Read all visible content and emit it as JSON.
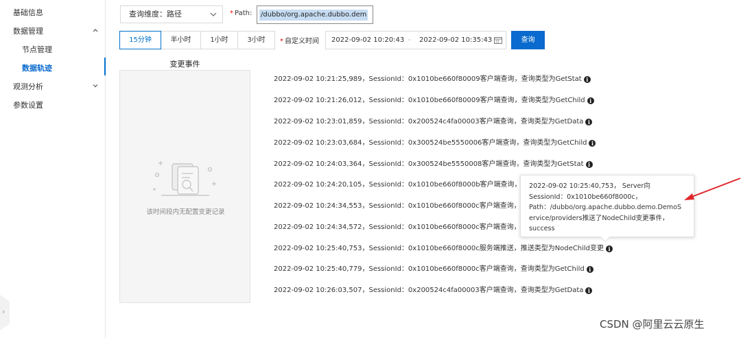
{
  "sidebar": {
    "items": [
      {
        "label": "基础信息"
      },
      {
        "label": "数据管理"
      },
      {
        "label": "节点管理"
      },
      {
        "label": "数据轨迹"
      },
      {
        "label": "观测分析"
      },
      {
        "label": "参数设置"
      }
    ]
  },
  "filters": {
    "dimension": "查询维度：路径",
    "path_label": "Path:",
    "path_value": "/dubbo/org.apache.dubbo.dem",
    "time_options": [
      "15分钟",
      "半小时",
      "1小时",
      "3小时"
    ],
    "selected_time": "15分钟",
    "custom_time_label": "自定义时间",
    "start_time": "2022-09-02 10:20:43",
    "range_separator": "-",
    "end_time": "2022-09-02 10:35:43",
    "query_button": "查询"
  },
  "change_panel": {
    "title": "变更事件",
    "empty_text": "该时间段内无配置变更记录"
  },
  "events": [
    {
      "text": "2022-09-02 10:21:25,989，SessionId：0x1010be660f80009客户端查询，查询类型为GetStat"
    },
    {
      "text": "2022-09-02 10:21:26,012，SessionId：0x1010be660f80009客户端查询，查询类型为GetChild"
    },
    {
      "text": "2022-09-02 10:23:01,859，SessionId：0x200524c4fa00003客户端查询，查询类型为GetData"
    },
    {
      "text": "2022-09-02 10:23:03,684，SessionId：0x300524be5550006客户端查询，查询类型为GetChild"
    },
    {
      "text": "2022-09-02 10:24:03,364，SessionId：0x300524be5550008客户端查询，查询类型为GetStat"
    },
    {
      "text": "2022-09-02 10:24:20,105，SessionId：0x1010be660f8000b客户端查询，查"
    },
    {
      "text": "2022-09-02 10:24:34,553，SessionId：0x1010be660f8000c客户端查询，查"
    },
    {
      "text": "2022-09-02 10:24:34,572，SessionId：0x1010be660f8000c客户端查询，查"
    },
    {
      "text": "2022-09-02 10:25:40,753，SessionId：0x1010be660f8000c服务端推送，推送类型为NodeChild变更"
    },
    {
      "text": "2022-09-02 10:25:40,779，SessionId：0x1010be660f8000c客户端查询，查询类型为GetChild"
    },
    {
      "text": "2022-09-02 10:26:03,507，SessionId：0x200524c4fa00003客户端查询，查询类型为GetData"
    }
  ],
  "tooltip": {
    "lines": [
      "2022-09-02 10:25:40,753， Server向",
      "SessionId：0x1010be660f8000c，",
      "Path：/dubbo/org.apache.dubbo.demo.DemoS",
      "ervice/providers推送了NodeChild变更事件，",
      "success"
    ]
  },
  "watermark": "CSDN @阿里云云原生",
  "colors": {
    "accent": "#0a6acd",
    "annotation_arrow": "#e0262b"
  }
}
